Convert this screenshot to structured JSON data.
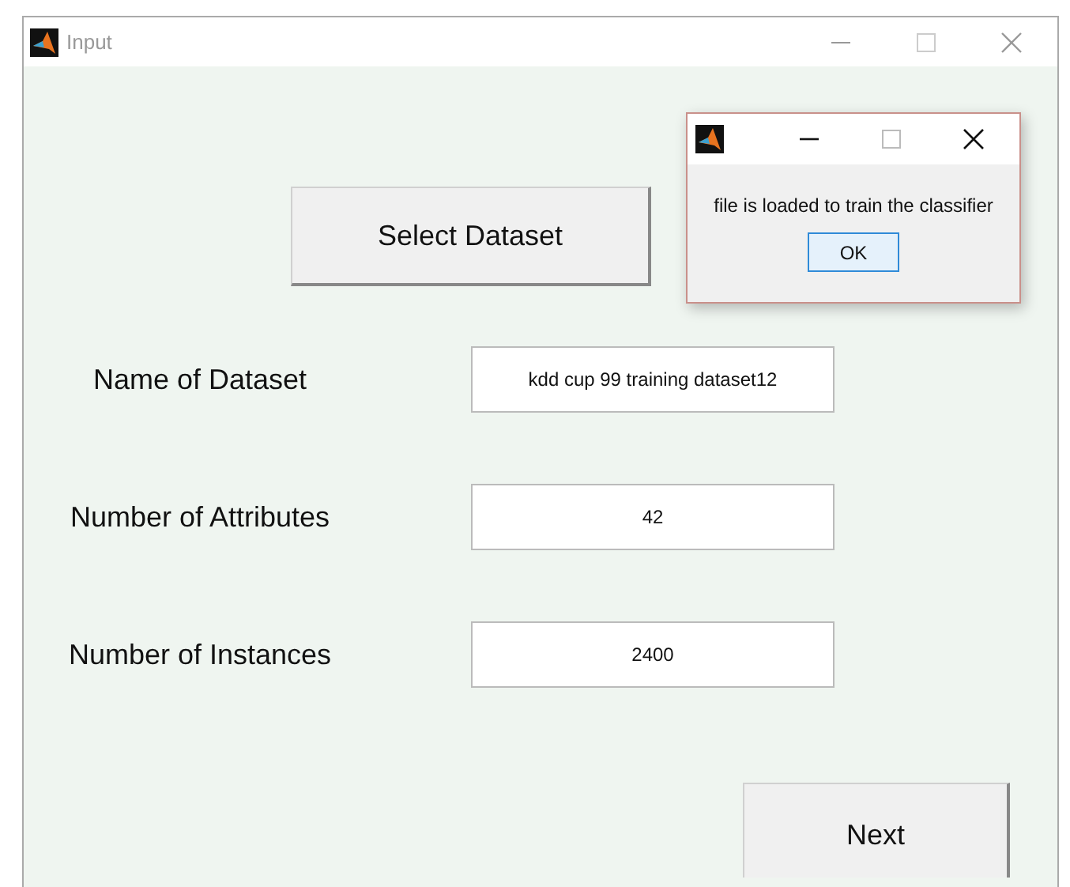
{
  "window": {
    "title": "Input"
  },
  "select_button": {
    "label": "Select Dataset"
  },
  "fields": [
    {
      "label": "Name of Dataset",
      "value": "kdd cup 99 training dataset12"
    },
    {
      "label": "Number of Attributes",
      "value": "42"
    },
    {
      "label": "Number of Instances",
      "value": "2400"
    }
  ],
  "next_button": {
    "label": "Next"
  },
  "dialog": {
    "message": "file is loaded to train the classifier",
    "button": "OK"
  }
}
